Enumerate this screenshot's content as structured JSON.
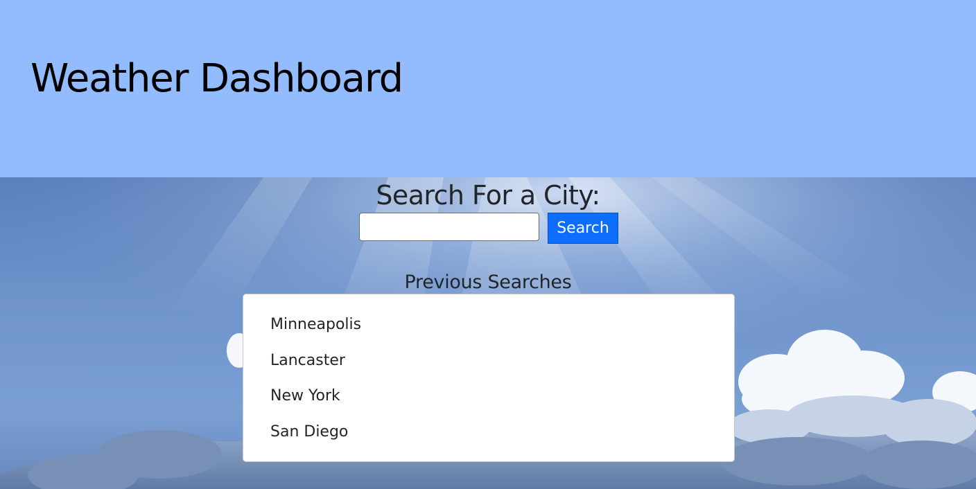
{
  "header": {
    "title": "Weather Dashboard",
    "background_color": "#92bcfd"
  },
  "search": {
    "heading": "Search For a City:",
    "input_value": "",
    "button_label": "Search",
    "button_color": "#0d6efd"
  },
  "history": {
    "heading": "Previous Searches",
    "items": [
      {
        "label": "Minneapolis"
      },
      {
        "label": "Lancaster"
      },
      {
        "label": "New York"
      },
      {
        "label": "San Diego"
      }
    ]
  }
}
